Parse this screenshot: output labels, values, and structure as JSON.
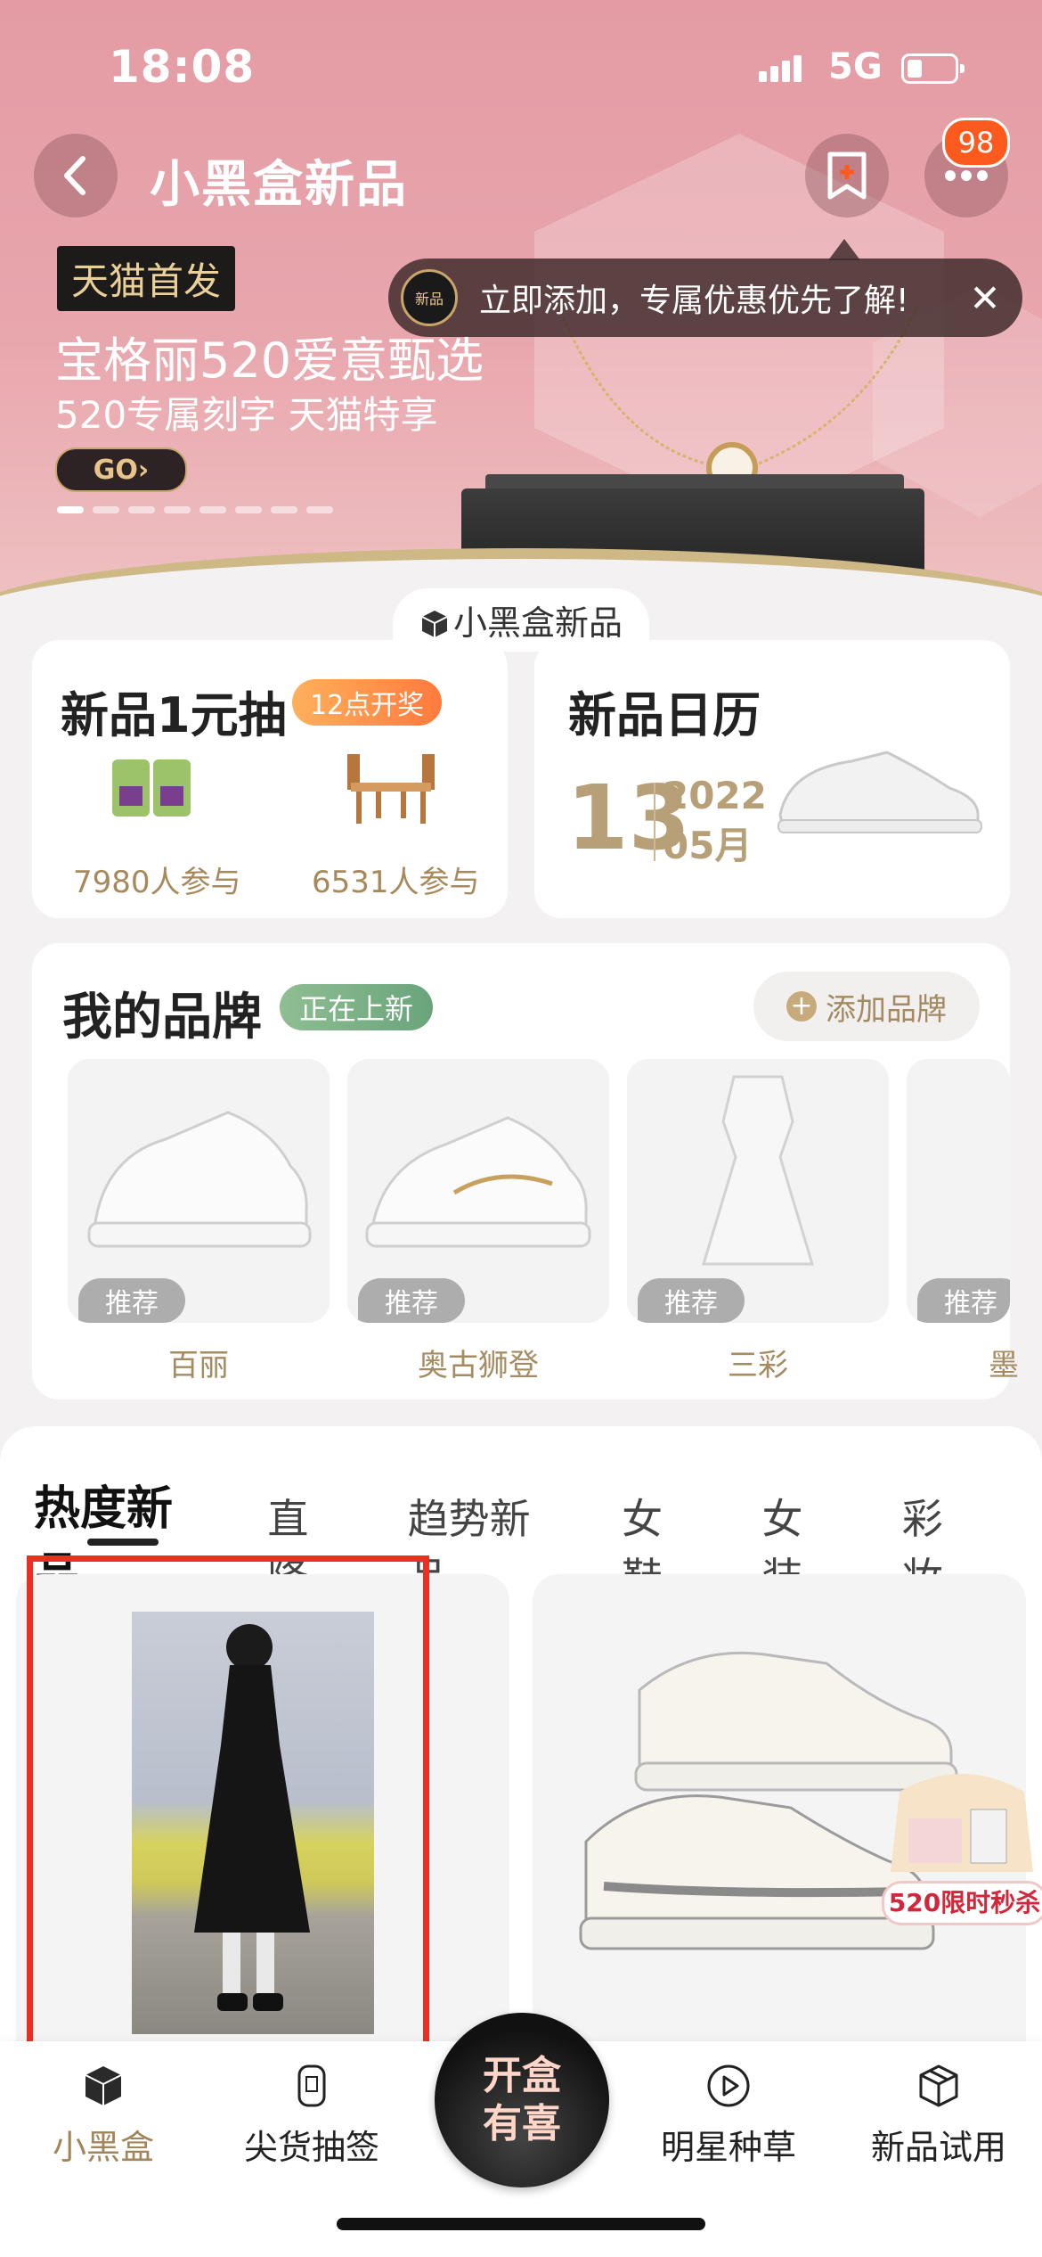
{
  "status_bar": {
    "time": "18:08",
    "network": "5G"
  },
  "header": {
    "title": "小黑盒新品",
    "badge_count": "98"
  },
  "banner": {
    "tag": "天猫首发",
    "title": "宝格丽520爱意甄选",
    "subtitle": "520专属刻字 天猫特享",
    "go_label": "GO›",
    "slide_count": 8,
    "active_slide": 1
  },
  "toast": {
    "logo_text": "新品",
    "text": "立即添加，专属优惠优先了解!"
  },
  "section_label": "小黑盒新品",
  "lottery": {
    "title": "新品1元抽",
    "pill": "12点开奖",
    "items": [
      {
        "count": "7980人参与"
      },
      {
        "count": "6531人参与"
      }
    ]
  },
  "calendar": {
    "title": "新品日历",
    "day": "13",
    "year": "2022",
    "month": "05月"
  },
  "my_brands": {
    "title": "我的品牌",
    "pill": "正在上新",
    "add_label": "添加品牌",
    "tag": "推荐",
    "items": [
      {
        "name": "百丽"
      },
      {
        "name": "奥古狮登"
      },
      {
        "name": "三彩"
      },
      {
        "name": "墨"
      }
    ]
  },
  "tabs": [
    "热度新品",
    "直降",
    "趋势新品",
    "女鞋",
    "女装",
    "彩妆"
  ],
  "flash_sale": {
    "label": "520限时秒杀"
  },
  "bottom_nav": {
    "items": [
      "小黑盒",
      "尖货抽签",
      "明星种草",
      "新品试用"
    ],
    "center_line1": "开盒",
    "center_line2": "有喜"
  },
  "colors": {
    "accent_gold": "#a3855a",
    "badge_orange": "#ff5a1d",
    "highlight_red": "#ee2f1f"
  }
}
